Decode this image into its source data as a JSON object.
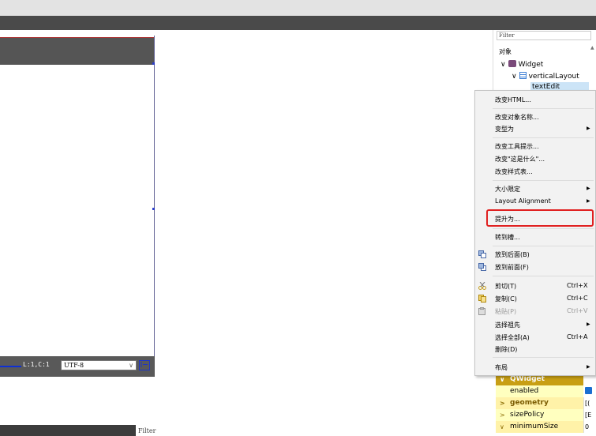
{
  "status_bar": {
    "line_col": "L:1,C:1",
    "encoding": "UTF-8",
    "encoding_dropdown": "∨"
  },
  "bottom": {
    "filter_text": "Filter"
  },
  "object_inspector": {
    "filter_text": "Filter",
    "column_header": "对象",
    "tree": {
      "root": "Widget",
      "layout": "verticalLayout",
      "selected": "textEdit"
    }
  },
  "context_menu": {
    "items": [
      {
        "label": "改变HTML...",
        "shortcut": "",
        "submenu": false,
        "disabled": false
      },
      {
        "label": "改变对象名称...",
        "shortcut": "",
        "submenu": false,
        "disabled": false
      },
      {
        "label": "变型为",
        "shortcut": "",
        "submenu": true,
        "disabled": false
      },
      {
        "label": "改变工具提示...",
        "shortcut": "",
        "submenu": false,
        "disabled": false
      },
      {
        "label": "改变\"这是什么\"...",
        "shortcut": "",
        "submenu": false,
        "disabled": false
      },
      {
        "label": "改变样式表...",
        "shortcut": "",
        "submenu": false,
        "disabled": false
      },
      {
        "label": "大小限定",
        "shortcut": "",
        "submenu": true,
        "disabled": false
      },
      {
        "label": "Layout Alignment",
        "shortcut": "",
        "submenu": true,
        "disabled": false
      },
      {
        "label": "提升为...",
        "shortcut": "",
        "submenu": false,
        "disabled": false
      },
      {
        "label": "转到槽...",
        "shortcut": "",
        "submenu": false,
        "disabled": false
      },
      {
        "label": "放到后面(B)",
        "shortcut": "",
        "submenu": false,
        "disabled": false
      },
      {
        "label": "放到前面(F)",
        "shortcut": "",
        "submenu": false,
        "disabled": false
      },
      {
        "label": "剪切(T)",
        "shortcut": "Ctrl+X",
        "submenu": false,
        "disabled": false
      },
      {
        "label": "复制(C)",
        "shortcut": "Ctrl+C",
        "submenu": false,
        "disabled": false
      },
      {
        "label": "粘贴(P)",
        "shortcut": "Ctrl+V",
        "submenu": false,
        "disabled": true
      },
      {
        "label": "选择祖先",
        "shortcut": "",
        "submenu": true,
        "disabled": false
      },
      {
        "label": "选择全部(A)",
        "shortcut": "Ctrl+A",
        "submenu": false,
        "disabled": false
      },
      {
        "label": "删除(D)",
        "shortcut": "",
        "submenu": false,
        "disabled": false
      },
      {
        "label": "布局",
        "shortcut": "",
        "submenu": true,
        "disabled": false
      }
    ],
    "submenu_arrow": "▶"
  },
  "property_editor": {
    "rows": [
      {
        "name": "QWidget",
        "kind": "group",
        "caret": "∨",
        "value": ""
      },
      {
        "name": "enabled",
        "kind": "prop",
        "caret": "",
        "value": ""
      },
      {
        "name": "geometry",
        "kind": "prop-bold",
        "caret": ">",
        "value": "[("
      },
      {
        "name": "sizePolicy",
        "kind": "prop",
        "caret": ">",
        "value": "[E"
      },
      {
        "name": "minimumSize",
        "kind": "prop",
        "caret": "∨",
        "value": "0"
      }
    ]
  },
  "colors": {
    "highlight_outline": "#e02020",
    "selection": "#cce4f7",
    "group_header": "#c89f14"
  }
}
